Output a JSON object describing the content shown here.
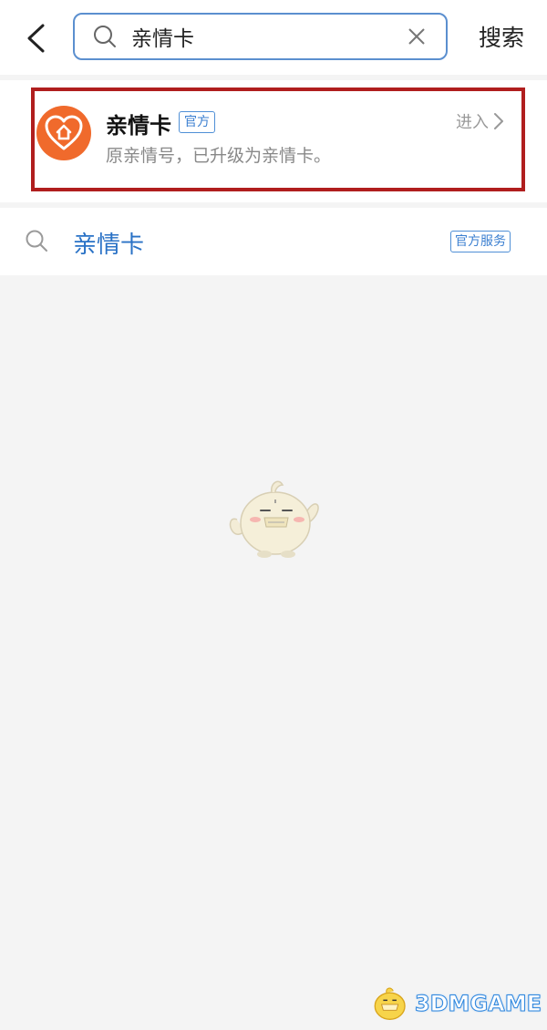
{
  "header": {
    "back_icon": "chevron-left-icon",
    "search": {
      "icon": "search-icon",
      "value": "亲情卡",
      "clear_icon": "close-icon"
    },
    "search_button_label": "搜索"
  },
  "result": {
    "app_logo_icon": "heart-home-icon",
    "name": "亲情卡",
    "badge": "官方",
    "description": "原亲情号，已升级为亲情卡。",
    "enter_label": "进入",
    "enter_icon": "chevron-right-icon",
    "highlight_color": "#b01e1e",
    "logo_color": "#f06a2c"
  },
  "suggestion": {
    "icon": "search-icon",
    "text": "亲情卡",
    "badge": "官方服务"
  },
  "watermark": {
    "text": "3DMGAME"
  }
}
